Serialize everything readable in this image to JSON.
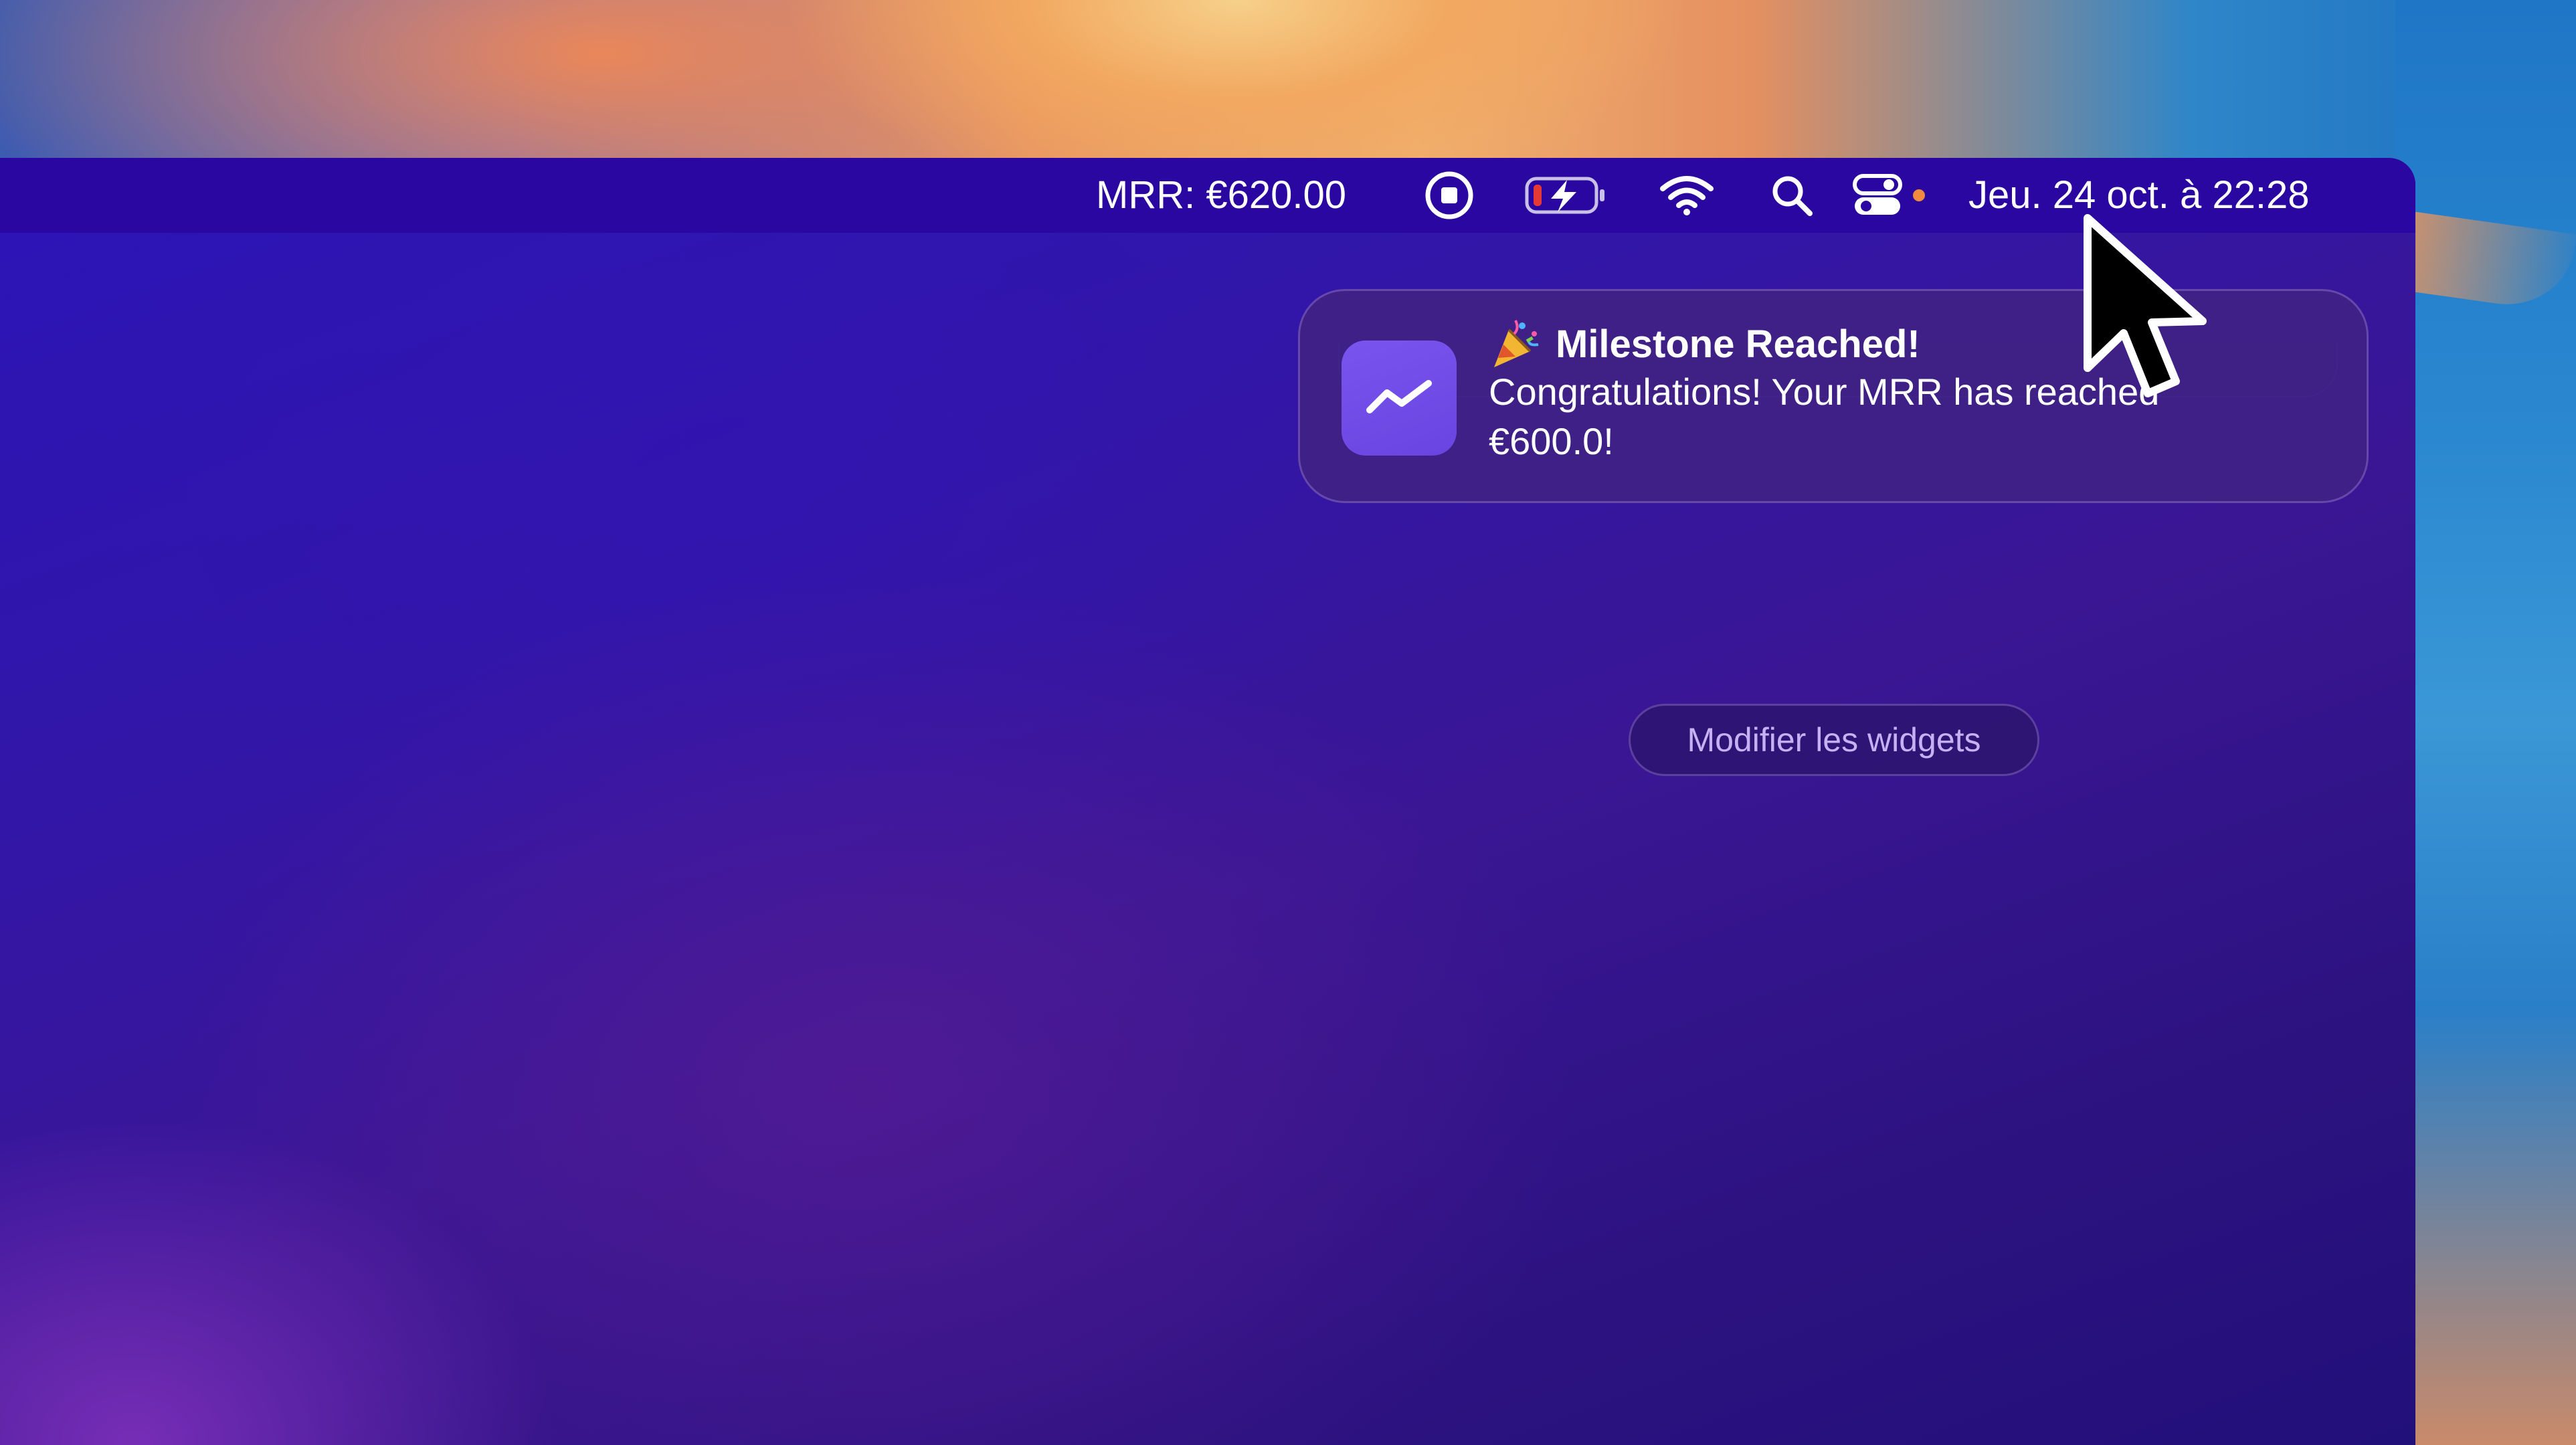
{
  "menubar": {
    "mrr_label": "MRR: €620.00",
    "status_icons": [
      "screen-record-icon",
      "battery-charging-icon",
      "wifi-icon",
      "search-icon",
      "control-center-icon"
    ],
    "datetime": "Jeu. 24 oct. à  22:28"
  },
  "notification": {
    "app_icon": "trending-up-chart-icon",
    "title_emoji": "party-popper-icon",
    "title": "Milestone Reached!",
    "body": "Congratulations! Your MRR has reached €600.0!"
  },
  "widgets_button": {
    "label": "Modifier les widgets"
  },
  "colors": {
    "menubar_bg": "#2a07a0",
    "accent_purple": "#6a44e0",
    "battery_low": "#e53935",
    "dot_orange": "#f08a3c"
  }
}
